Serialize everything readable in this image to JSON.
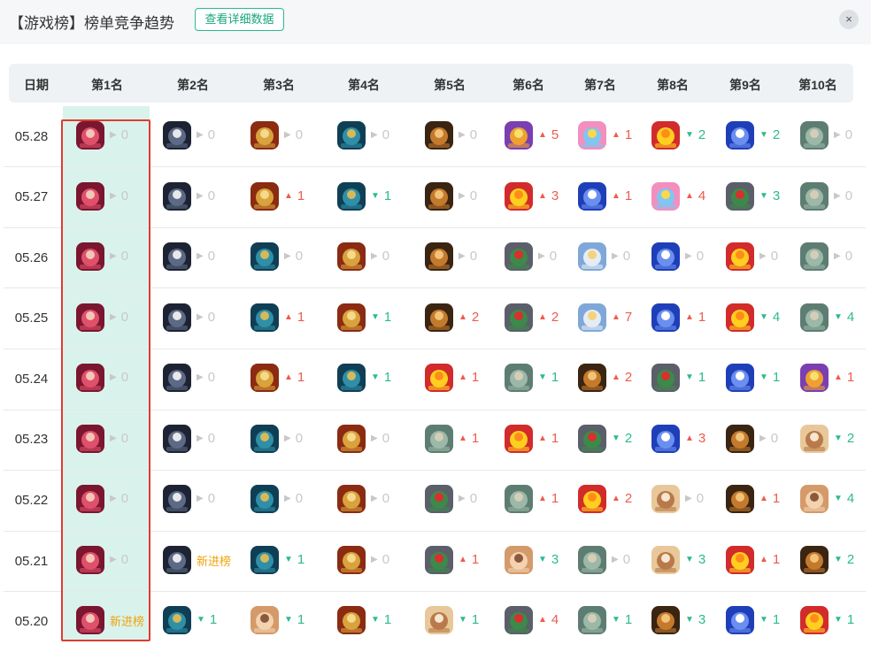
{
  "header": {
    "title": "【游戏榜】榜单竞争趋势",
    "detail_button": "查看详细数据",
    "close_icon": "×"
  },
  "columns": [
    "日期",
    "第1名",
    "第2名",
    "第3名",
    "第4名",
    "第5名",
    "第6名",
    "第7名",
    "第8名",
    "第9名",
    "第10名"
  ],
  "legend": {
    "new_label": "新进榜"
  },
  "games": {
    "hero": {
      "name": "red-warrior-game-icon",
      "colors": [
        "#7a1630",
        "#e0506a",
        "#f3c7b8"
      ]
    },
    "knight": {
      "name": "dark-swordsman-game-icon",
      "colors": [
        "#1d2333",
        "#5c6a86",
        "#e8e8ea"
      ]
    },
    "armor": {
      "name": "golden-armor-hero-game-icon",
      "colors": [
        "#8a2b12",
        "#d9a23c",
        "#f5d98c"
      ]
    },
    "tank": {
      "name": "teal-tank-game-icon",
      "colors": [
        "#0f3f55",
        "#2f8fa8",
        "#d6b95a"
      ]
    },
    "tiger": {
      "name": "tiger-warrior-game-icon",
      "colors": [
        "#3a2412",
        "#c47a2c",
        "#f1c27a"
      ]
    },
    "duck": {
      "name": "yellow-duck-game-icon",
      "colors": [
        "#d22b2b",
        "#ffcf1f",
        "#ff8c1a"
      ]
    },
    "party": {
      "name": "pink-party-game-icon",
      "colors": [
        "#f28fbf",
        "#7ec7f2",
        "#ffd84a"
      ]
    },
    "penguin": {
      "name": "blue-penguin-game-icon",
      "colors": [
        "#1f3fb8",
        "#6a8ff0",
        "#ffffff"
      ]
    },
    "stone": {
      "name": "stone-face-game-icon",
      "colors": [
        "#5e7d72",
        "#9bb8a8",
        "#d6cdb8"
      ]
    },
    "racing": {
      "name": "racing-road-game-icon",
      "colors": [
        "#5a5f6a",
        "#3c8a4a",
        "#d92f2f"
      ]
    },
    "cat": {
      "name": "white-cat-game-icon",
      "colors": [
        "#7fa8d8",
        "#e6ecf6",
        "#f4d37a"
      ]
    },
    "girl": {
      "name": "anime-girl-game-icon",
      "colors": [
        "#e8c89a",
        "#b87a4a",
        "#f7e7d2"
      ]
    },
    "dance": {
      "name": "dancing-girl-game-icon",
      "colors": [
        "#d49a6a",
        "#f3d2b0",
        "#8a5a3a"
      ]
    },
    "cannon": {
      "name": "purple-cannon-game-icon",
      "colors": [
        "#7a3fb0",
        "#f0a030",
        "#f5e070"
      ]
    }
  },
  "rows": [
    {
      "date": "05.28",
      "cells": [
        {
          "g": "hero",
          "t": "same",
          "v": "0"
        },
        {
          "g": "knight",
          "t": "same",
          "v": "0"
        },
        {
          "g": "armor",
          "t": "same",
          "v": "0"
        },
        {
          "g": "tank",
          "t": "same",
          "v": "0"
        },
        {
          "g": "tiger",
          "t": "same",
          "v": "0"
        },
        {
          "g": "cannon",
          "t": "up",
          "v": "5"
        },
        {
          "g": "party",
          "t": "up",
          "v": "1"
        },
        {
          "g": "duck",
          "t": "down",
          "v": "2"
        },
        {
          "g": "penguin",
          "t": "down",
          "v": "2"
        },
        {
          "g": "stone",
          "t": "same",
          "v": "0"
        }
      ]
    },
    {
      "date": "05.27",
      "cells": [
        {
          "g": "hero",
          "t": "same",
          "v": "0"
        },
        {
          "g": "knight",
          "t": "same",
          "v": "0"
        },
        {
          "g": "armor",
          "t": "up",
          "v": "1"
        },
        {
          "g": "tank",
          "t": "down",
          "v": "1"
        },
        {
          "g": "tiger",
          "t": "same",
          "v": "0"
        },
        {
          "g": "duck",
          "t": "up",
          "v": "3"
        },
        {
          "g": "penguin",
          "t": "up",
          "v": "1"
        },
        {
          "g": "party",
          "t": "up",
          "v": "4"
        },
        {
          "g": "racing",
          "t": "down",
          "v": "3"
        },
        {
          "g": "stone",
          "t": "same",
          "v": "0"
        }
      ]
    },
    {
      "date": "05.26",
      "cells": [
        {
          "g": "hero",
          "t": "same",
          "v": "0"
        },
        {
          "g": "knight",
          "t": "same",
          "v": "0"
        },
        {
          "g": "tank",
          "t": "same",
          "v": "0"
        },
        {
          "g": "armor",
          "t": "same",
          "v": "0"
        },
        {
          "g": "tiger",
          "t": "same",
          "v": "0"
        },
        {
          "g": "racing",
          "t": "same",
          "v": "0"
        },
        {
          "g": "cat",
          "t": "same",
          "v": "0"
        },
        {
          "g": "penguin",
          "t": "same",
          "v": "0"
        },
        {
          "g": "duck",
          "t": "same",
          "v": "0"
        },
        {
          "g": "stone",
          "t": "same",
          "v": "0"
        }
      ]
    },
    {
      "date": "05.25",
      "cells": [
        {
          "g": "hero",
          "t": "same",
          "v": "0"
        },
        {
          "g": "knight",
          "t": "same",
          "v": "0"
        },
        {
          "g": "tank",
          "t": "up",
          "v": "1"
        },
        {
          "g": "armor",
          "t": "down",
          "v": "1"
        },
        {
          "g": "tiger",
          "t": "up",
          "v": "2"
        },
        {
          "g": "racing",
          "t": "up",
          "v": "2"
        },
        {
          "g": "cat",
          "t": "up",
          "v": "7"
        },
        {
          "g": "penguin",
          "t": "up",
          "v": "1"
        },
        {
          "g": "duck",
          "t": "down",
          "v": "4"
        },
        {
          "g": "stone",
          "t": "down",
          "v": "4"
        }
      ]
    },
    {
      "date": "05.24",
      "cells": [
        {
          "g": "hero",
          "t": "same",
          "v": "0"
        },
        {
          "g": "knight",
          "t": "same",
          "v": "0"
        },
        {
          "g": "armor",
          "t": "up",
          "v": "1"
        },
        {
          "g": "tank",
          "t": "down",
          "v": "1"
        },
        {
          "g": "duck",
          "t": "up",
          "v": "1"
        },
        {
          "g": "stone",
          "t": "down",
          "v": "1"
        },
        {
          "g": "tiger",
          "t": "up",
          "v": "2"
        },
        {
          "g": "racing",
          "t": "down",
          "v": "1"
        },
        {
          "g": "penguin",
          "t": "down",
          "v": "1"
        },
        {
          "g": "cannon",
          "t": "up",
          "v": "1"
        }
      ]
    },
    {
      "date": "05.23",
      "cells": [
        {
          "g": "hero",
          "t": "same",
          "v": "0"
        },
        {
          "g": "knight",
          "t": "same",
          "v": "0"
        },
        {
          "g": "tank",
          "t": "same",
          "v": "0"
        },
        {
          "g": "armor",
          "t": "same",
          "v": "0"
        },
        {
          "g": "stone",
          "t": "up",
          "v": "1"
        },
        {
          "g": "duck",
          "t": "up",
          "v": "1"
        },
        {
          "g": "racing",
          "t": "down",
          "v": "2"
        },
        {
          "g": "penguin",
          "t": "up",
          "v": "3"
        },
        {
          "g": "tiger",
          "t": "same",
          "v": "0"
        },
        {
          "g": "girl",
          "t": "down",
          "v": "2"
        }
      ]
    },
    {
      "date": "05.22",
      "cells": [
        {
          "g": "hero",
          "t": "same",
          "v": "0"
        },
        {
          "g": "knight",
          "t": "same",
          "v": "0"
        },
        {
          "g": "tank",
          "t": "same",
          "v": "0"
        },
        {
          "g": "armor",
          "t": "same",
          "v": "0"
        },
        {
          "g": "racing",
          "t": "same",
          "v": "0"
        },
        {
          "g": "stone",
          "t": "up",
          "v": "1"
        },
        {
          "g": "duck",
          "t": "up",
          "v": "2"
        },
        {
          "g": "girl",
          "t": "same",
          "v": "0"
        },
        {
          "g": "tiger",
          "t": "up",
          "v": "1"
        },
        {
          "g": "dance",
          "t": "down",
          "v": "4"
        }
      ]
    },
    {
      "date": "05.21",
      "cells": [
        {
          "g": "hero",
          "t": "same",
          "v": "0"
        },
        {
          "g": "knight",
          "t": "new",
          "v": "新进榜"
        },
        {
          "g": "tank",
          "t": "down",
          "v": "1"
        },
        {
          "g": "armor",
          "t": "same",
          "v": "0"
        },
        {
          "g": "racing",
          "t": "up",
          "v": "1"
        },
        {
          "g": "dance",
          "t": "down",
          "v": "3"
        },
        {
          "g": "stone",
          "t": "same",
          "v": "0"
        },
        {
          "g": "girl",
          "t": "down",
          "v": "3"
        },
        {
          "g": "duck",
          "t": "up",
          "v": "1"
        },
        {
          "g": "tiger",
          "t": "down",
          "v": "2"
        }
      ]
    },
    {
      "date": "05.20",
      "cells": [
        {
          "g": "hero",
          "t": "new",
          "v": "新进榜"
        },
        {
          "g": "tank",
          "t": "down",
          "v": "1"
        },
        {
          "g": "dance",
          "t": "down",
          "v": "1"
        },
        {
          "g": "armor",
          "t": "down",
          "v": "1"
        },
        {
          "g": "girl",
          "t": "down",
          "v": "1"
        },
        {
          "g": "racing",
          "t": "up",
          "v": "4"
        },
        {
          "g": "stone",
          "t": "down",
          "v": "1"
        },
        {
          "g": "tiger",
          "t": "down",
          "v": "3"
        },
        {
          "g": "penguin",
          "t": "down",
          "v": "1"
        },
        {
          "g": "duck",
          "t": "down",
          "v": "1"
        }
      ]
    }
  ]
}
